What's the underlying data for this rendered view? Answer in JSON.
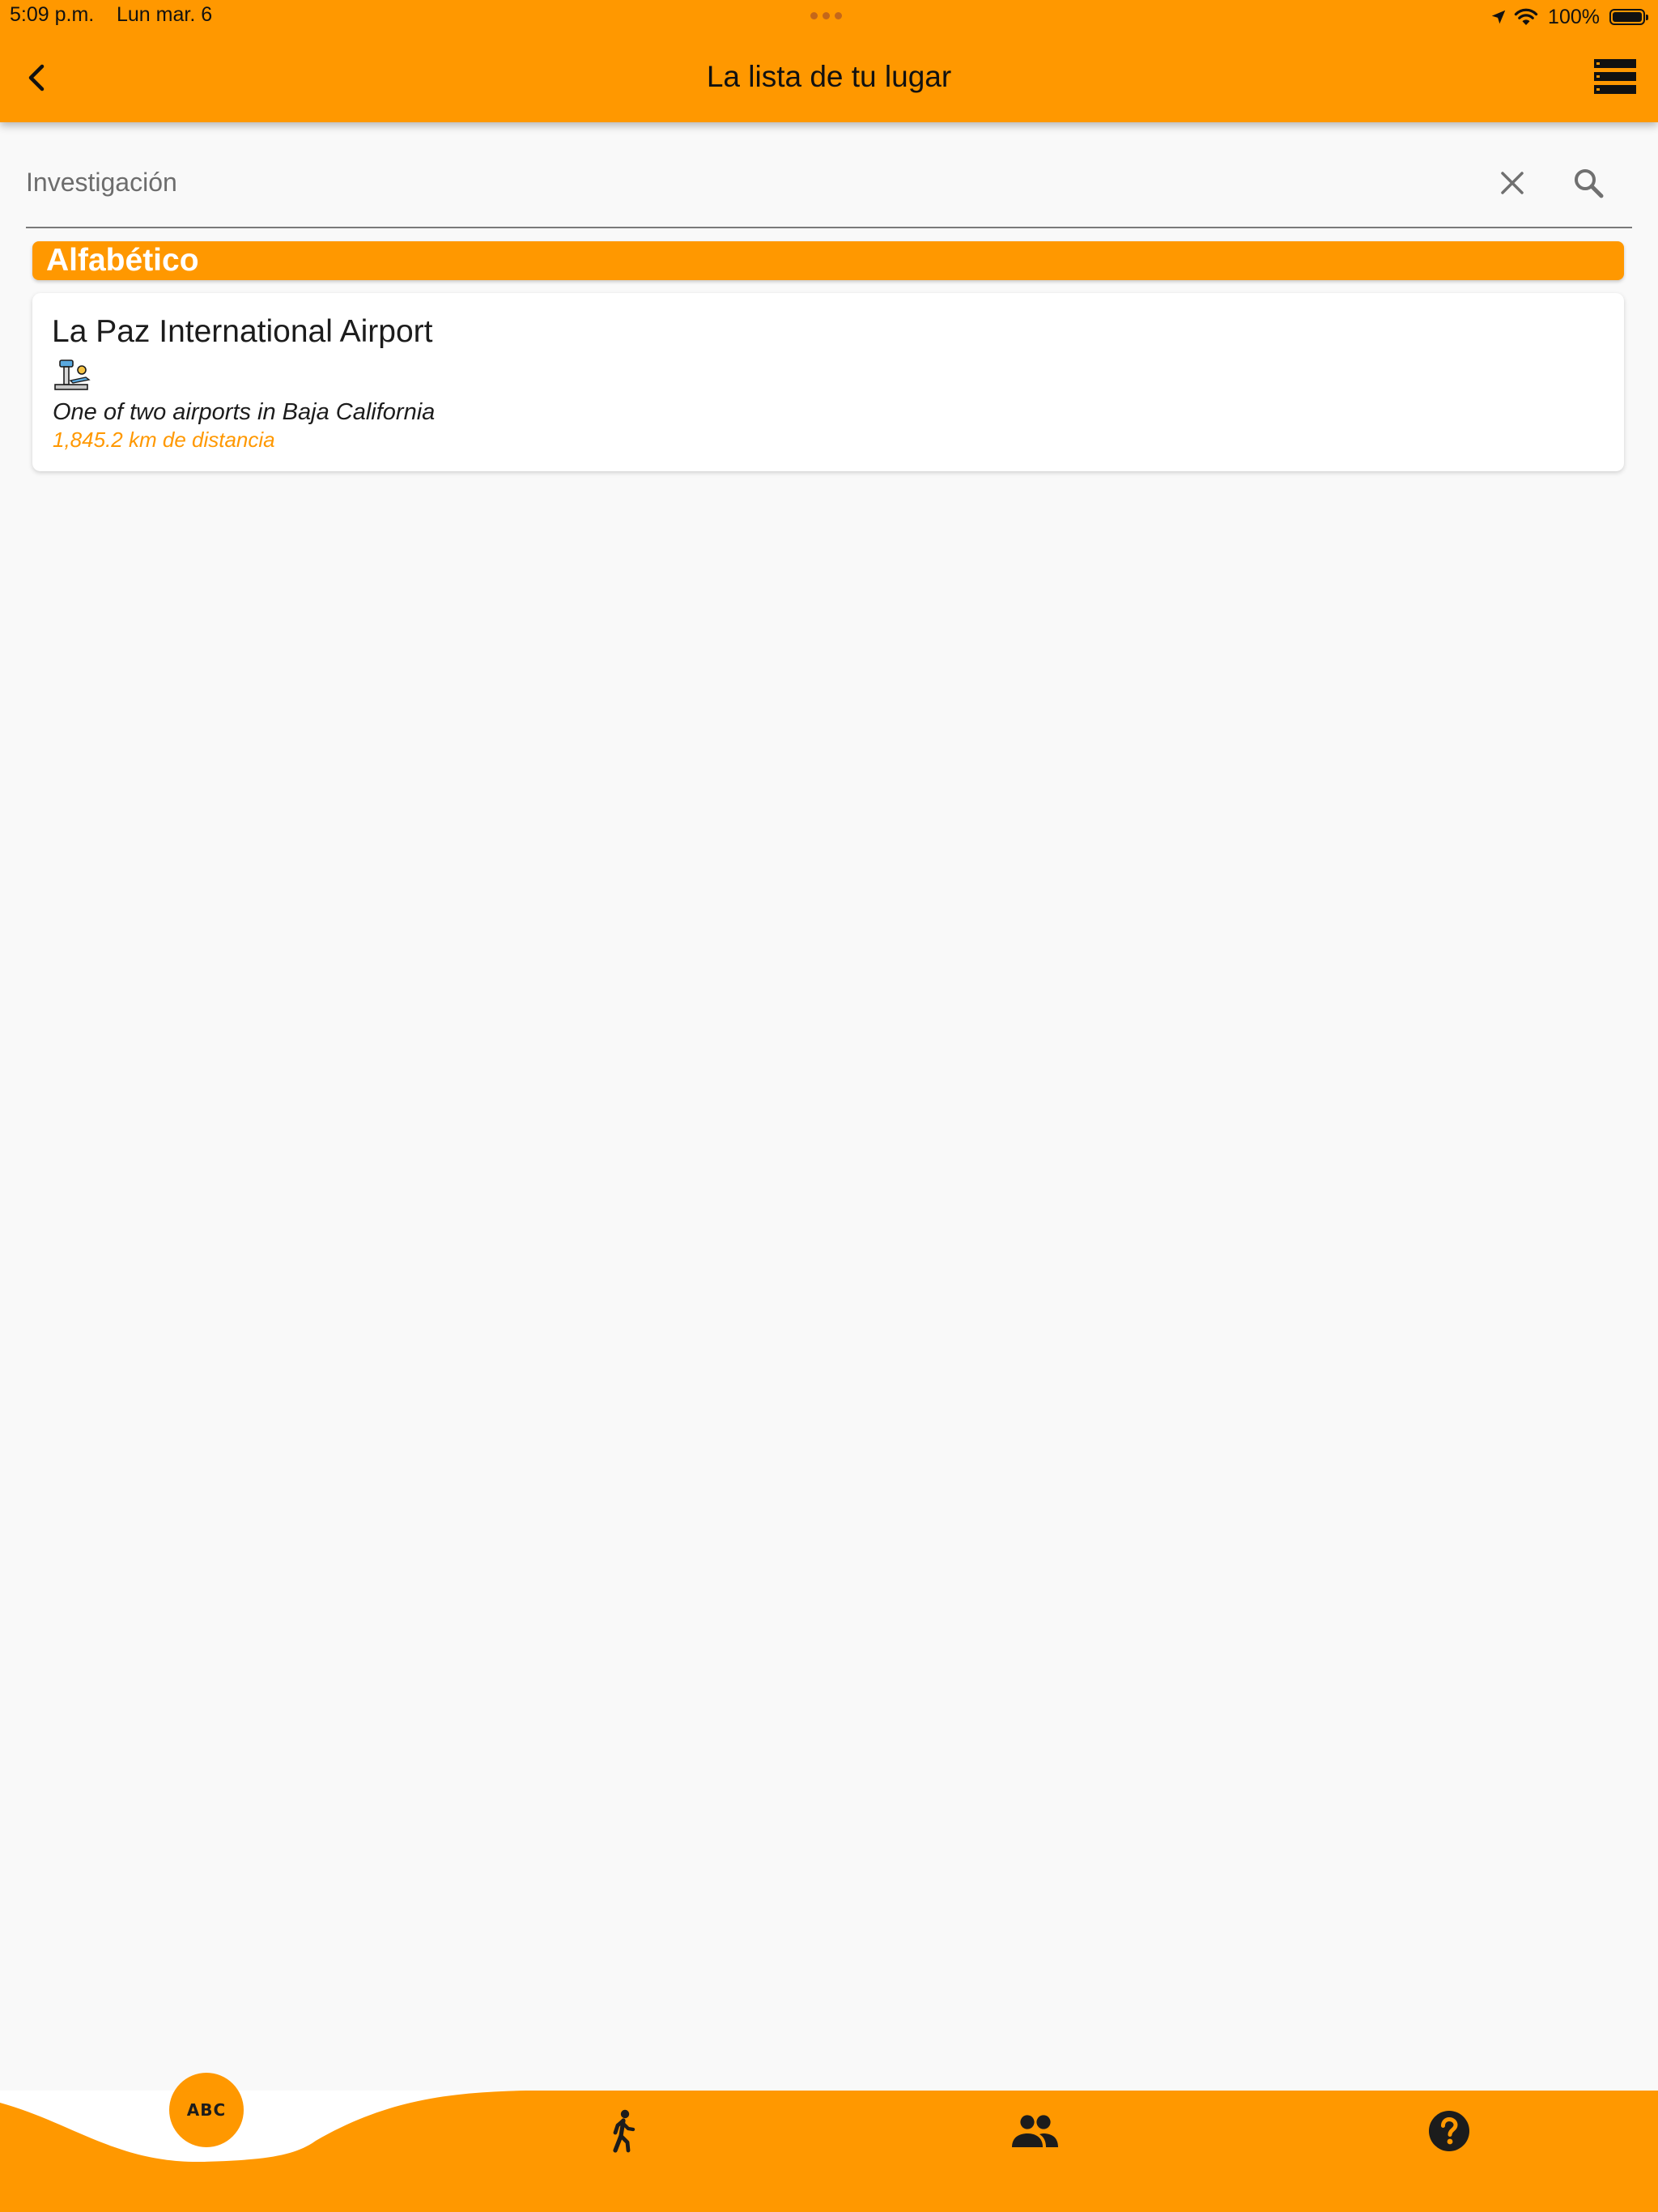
{
  "status_bar": {
    "time": "5:09 p.m.",
    "date": "Lun mar. 6",
    "battery_percent": "100%",
    "icons": [
      "location-arrow-icon",
      "wifi-icon",
      "battery-icon"
    ]
  },
  "header": {
    "title": "La lista de tu lugar",
    "back_icon": "chevron-left-icon",
    "menu_icon": "list-view-icon",
    "color": "#ff9800"
  },
  "search": {
    "placeholder": "Investigación",
    "value": "",
    "clear_icon": "close-icon",
    "search_icon": "search-icon"
  },
  "section": {
    "title": "Alfabético"
  },
  "places": [
    {
      "name": "La Paz International Airport",
      "icon": "airport-icon",
      "description": "One of two airports in Baja California",
      "distance": "1,845.2 km de distancia"
    }
  ],
  "bottom_nav": {
    "items": [
      {
        "label": "ABC",
        "icon": "abc-icon",
        "active": true
      },
      {
        "icon": "walking-person-icon",
        "active": false
      },
      {
        "icon": "people-icon",
        "active": false
      },
      {
        "icon": "help-icon",
        "active": false
      }
    ],
    "accent_color": "#ff9800"
  }
}
